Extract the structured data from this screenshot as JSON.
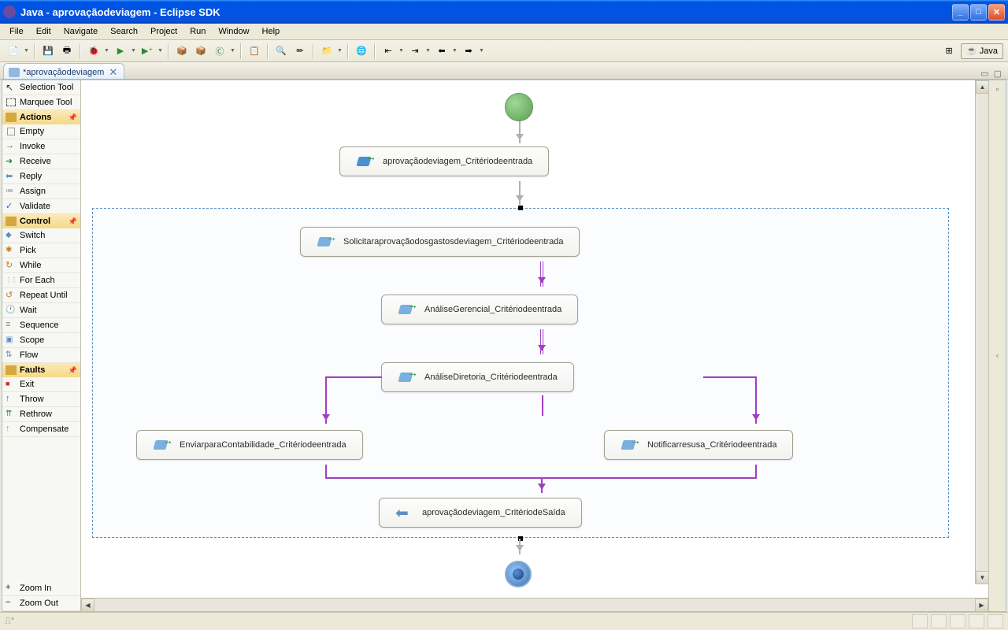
{
  "window": {
    "title": "Java - aprovaçãodeviagem - Eclipse SDK"
  },
  "menu": {
    "items": [
      "File",
      "Edit",
      "Navigate",
      "Search",
      "Project",
      "Run",
      "Window",
      "Help"
    ]
  },
  "perspective": {
    "label": "Java"
  },
  "tab": {
    "label": "*aprovaçãodeviagem"
  },
  "palette": {
    "tools": [
      {
        "label": "Selection Tool",
        "icon": "cursor"
      },
      {
        "label": "Marquee Tool",
        "icon": "marquee"
      }
    ],
    "sections": [
      {
        "header": "Actions",
        "items": [
          {
            "label": "Empty",
            "icon": "empty"
          },
          {
            "label": "Invoke",
            "icon": "invoke"
          },
          {
            "label": "Receive",
            "icon": "receive"
          },
          {
            "label": "Reply",
            "icon": "reply"
          },
          {
            "label": "Assign",
            "icon": "assign"
          },
          {
            "label": "Validate",
            "icon": "validate"
          }
        ]
      },
      {
        "header": "Control",
        "items": [
          {
            "label": "Switch",
            "icon": "switch"
          },
          {
            "label": "Pick",
            "icon": "pick"
          },
          {
            "label": "While",
            "icon": "while"
          },
          {
            "label": "For Each",
            "icon": "foreach"
          },
          {
            "label": "Repeat Until",
            "icon": "repeat"
          },
          {
            "label": "Wait",
            "icon": "wait"
          },
          {
            "label": "Sequence",
            "icon": "seq"
          },
          {
            "label": "Scope",
            "icon": "scope"
          },
          {
            "label": "Flow",
            "icon": "flow"
          }
        ]
      },
      {
        "header": "Faults",
        "items": [
          {
            "label": "Exit",
            "icon": "exit"
          },
          {
            "label": "Throw",
            "icon": "throw"
          },
          {
            "label": "Rethrow",
            "icon": "rethrow"
          },
          {
            "label": "Compensate",
            "icon": "comp"
          }
        ]
      }
    ],
    "zoom": {
      "in": "Zoom In",
      "out": "Zoom Out"
    }
  },
  "diagram": {
    "nodes": {
      "n1": "aprovaçãodeviagem_Critériodeentrada",
      "n2": "Solicitaraprovaçãodosgastosdeviagem_Critériodeentrada",
      "n3": "AnáliseGerencial_Critériodeentrada",
      "n4": "AnáliseDiretoria_Critériodeentrada",
      "n5": "EnviarparaContabilidade_Critériodeentrada",
      "n6": "Notificarresusa_Critériodeentrada",
      "n7": "aprovaçãodeviagem_CritériodeSaída"
    }
  }
}
